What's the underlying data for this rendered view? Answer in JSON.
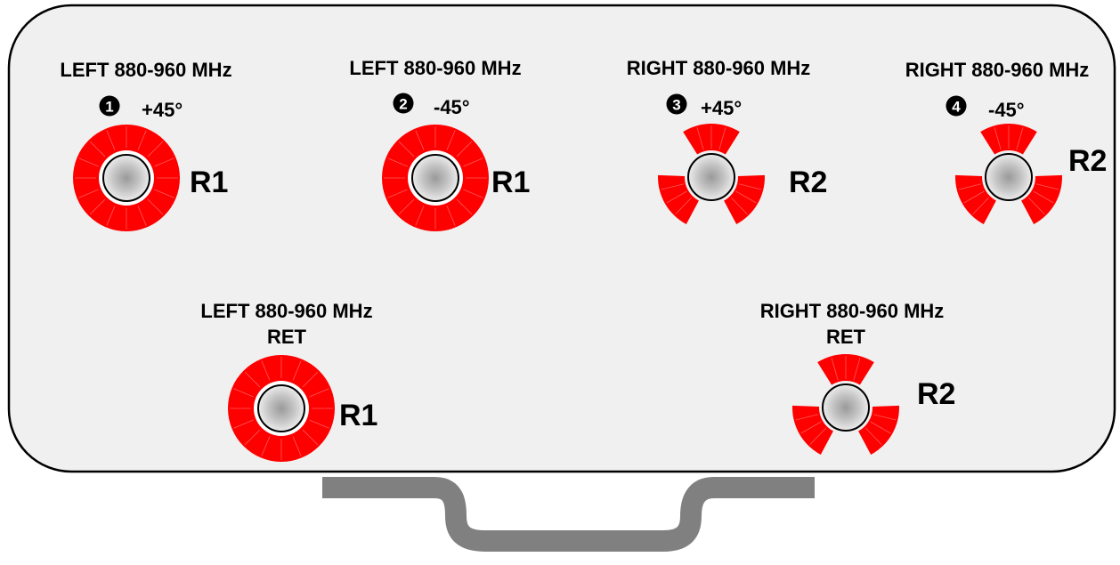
{
  "colors": {
    "panel_fill": "#f0f0f0",
    "panel_border": "#000000",
    "connector_red": "#ff0000",
    "bracket": "#808080",
    "marker_fill": "#000000"
  },
  "connectors": [
    {
      "band_label": "LEFT 880-960 MHz",
      "port_marker": "1",
      "polarization": "+45°",
      "radio_label": "R1",
      "style": "ring",
      "icon": "red-ring-connector-icon"
    },
    {
      "band_label": "LEFT 880-960 MHz",
      "port_marker": "2",
      "polarization": "-45°",
      "radio_label": "R1",
      "style": "ring",
      "icon": "red-ring-connector-icon"
    },
    {
      "band_label": "RIGHT 880-960 MHz",
      "port_marker": "3",
      "polarization": "+45°",
      "radio_label": "R2",
      "style": "trefoil",
      "icon": "red-trefoil-connector-icon"
    },
    {
      "band_label": "RIGHT 880-960 MHz",
      "port_marker": "4",
      "polarization": "-45°",
      "radio_label": "R2",
      "style": "trefoil",
      "icon": "red-trefoil-connector-icon"
    }
  ],
  "ret_connectors": [
    {
      "band_label": "LEFT 880-960 MHz",
      "sub_label": "RET",
      "radio_label": "R1",
      "style": "ring",
      "icon": "red-ring-connector-icon"
    },
    {
      "band_label": "RIGHT 880-960 MHz",
      "sub_label": "RET",
      "radio_label": "R2",
      "style": "trefoil",
      "icon": "red-trefoil-connector-icon"
    }
  ]
}
